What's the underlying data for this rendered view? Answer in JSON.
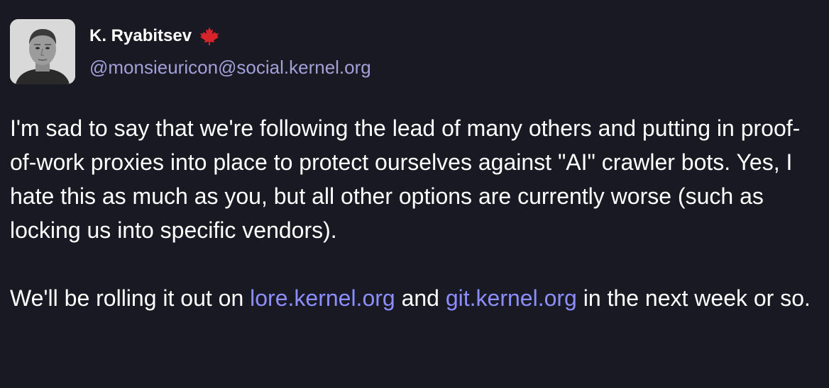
{
  "author": {
    "display_name": "K. Ryabitsev",
    "handle": "@monsieuricon@social.kernel.org",
    "flag_icon": "maple-leaf-icon",
    "flag_color": "#d8232a"
  },
  "post": {
    "paragraph1": "I'm sad to say that we're following the lead of many others and putting in proof-of-work proxies into place to protect ourselves against \"AI\" crawler bots. Yes, I hate this as much as you, but all other options are currently worse (such as locking us into specific vendors).",
    "paragraph2_before": "We'll be rolling it out on ",
    "link1": "lore.kernel.org",
    "paragraph2_middle": " and ",
    "link2": "git.kernel.org",
    "paragraph2_after": " in the next week or so."
  },
  "colors": {
    "background": "#191923",
    "text": "#ffffff",
    "handle": "#a2a0d8",
    "link": "#8c8dff"
  }
}
